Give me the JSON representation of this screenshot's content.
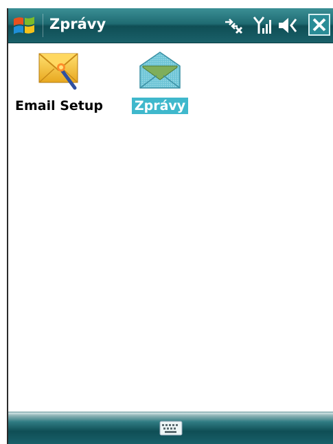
{
  "titlebar": {
    "title": "Zprávy",
    "icons": [
      "windows-start-icon",
      "connectivity-icon",
      "signal-icon",
      "volume-icon",
      "close-icon"
    ]
  },
  "apps": [
    {
      "label": "Email Setup",
      "icon": "email-setup-icon",
      "selected": false
    },
    {
      "label": "Zprávy",
      "icon": "envelope-icon",
      "selected": true
    }
  ],
  "bottombar": {
    "icon": "keyboard-icon"
  },
  "colors": {
    "titlebar": "#1f6b72",
    "selection": "#3fb8cc"
  }
}
